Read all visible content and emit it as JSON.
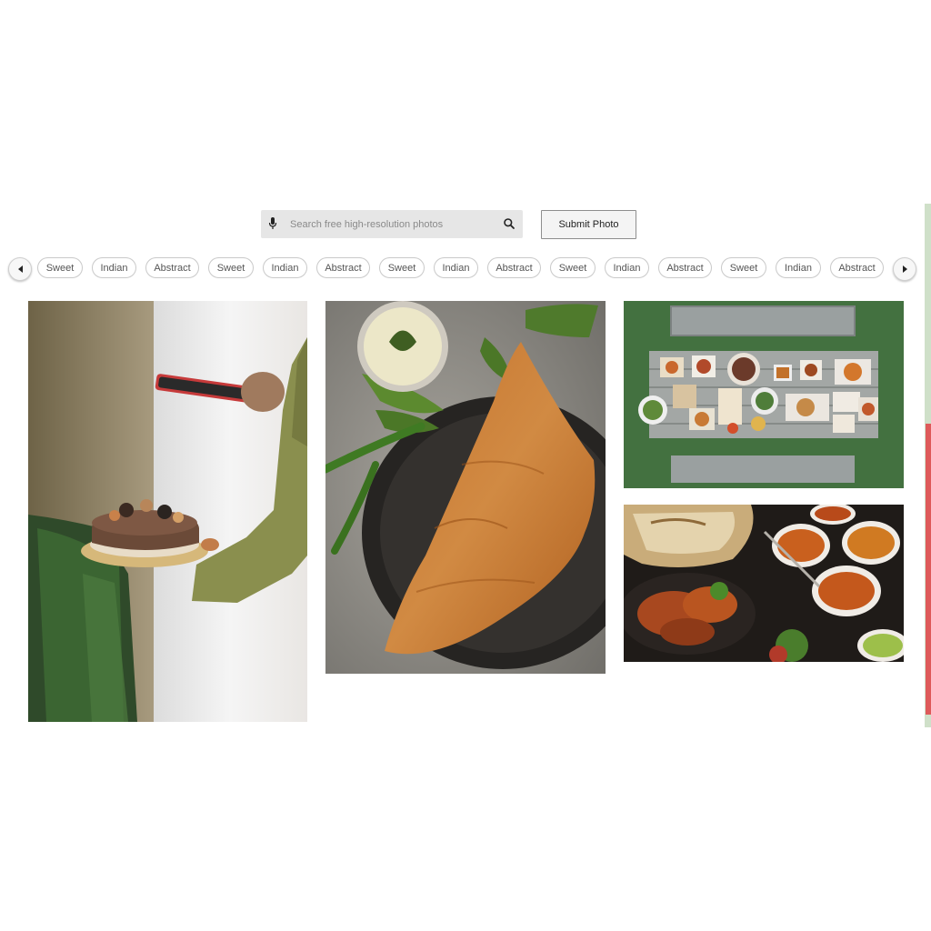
{
  "search": {
    "placeholder": "Search free high-resolution photos",
    "value": "",
    "mic_icon": "microphone-icon",
    "search_icon": "magnifier-icon"
  },
  "submit": {
    "label": "Submit Photo"
  },
  "tags": {
    "prev_icon": "caret-left-icon",
    "next_icon": "caret-right-icon",
    "items": [
      "Sweet",
      "Indian",
      "Abstract",
      "Sweet",
      "Indian",
      "Abstract",
      "Sweet",
      "Indian",
      "Abstract",
      "Sweet",
      "Indian",
      "Abstract",
      "Sweet",
      "Indian",
      "Abstract"
    ]
  },
  "gallery": {
    "photos": [
      {
        "subject": "cake-held-while-photographing-with-phone"
      },
      {
        "subject": "dosa-on-black-plate-with-chutney"
      },
      {
        "subject": "picnic-table-with-dishes-top-view"
      },
      {
        "subject": "indian-curries-and-naan-spread"
      }
    ]
  }
}
